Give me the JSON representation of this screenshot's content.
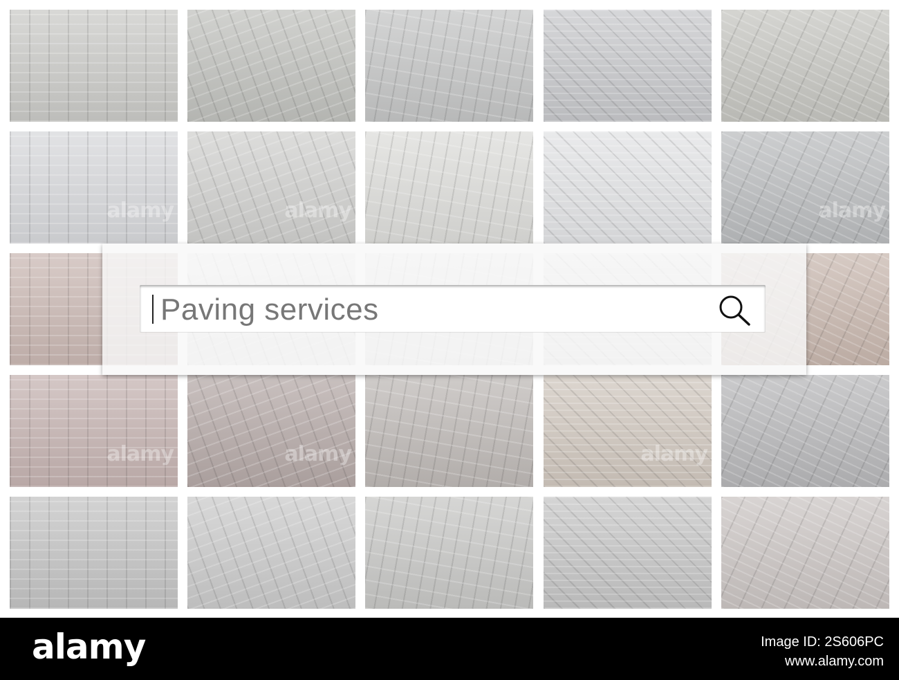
{
  "search": {
    "query": "Paving services"
  },
  "watermark": {
    "text": "alamy"
  },
  "footer": {
    "logo": "alamy",
    "image_id": "Image ID: 2S606PC",
    "url": "www.alamy.com"
  },
  "tiles": [
    {
      "base": "#c9c9c6"
    },
    {
      "base": "#bfc0bc"
    },
    {
      "base": "#c3c4c4"
    },
    {
      "base": "#c6c7ca"
    },
    {
      "base": "#c4c4bf"
    },
    {
      "base": "#d6d7da"
    },
    {
      "base": "#cfcfcd"
    },
    {
      "base": "#dcdcd9"
    },
    {
      "base": "#e1e2e4"
    },
    {
      "base": "#b9bbbd"
    },
    {
      "base": "#c9b7b2"
    },
    {
      "base": "#e8e8e8"
    },
    {
      "base": "#e6e6e6"
    },
    {
      "base": "#e6e6e6"
    },
    {
      "base": "#c7b6ad"
    },
    {
      "base": "#c4b2b0"
    },
    {
      "base": "#b4a8a6"
    },
    {
      "base": "#bdb8b5"
    },
    {
      "base": "#cfc6bd"
    },
    {
      "base": "#b6b6b8"
    },
    {
      "base": "#c2c2c2"
    },
    {
      "base": "#c9c9c9"
    },
    {
      "base": "#c6c6c4"
    },
    {
      "base": "#c4c4c4"
    },
    {
      "base": "#c9c3c1"
    }
  ]
}
